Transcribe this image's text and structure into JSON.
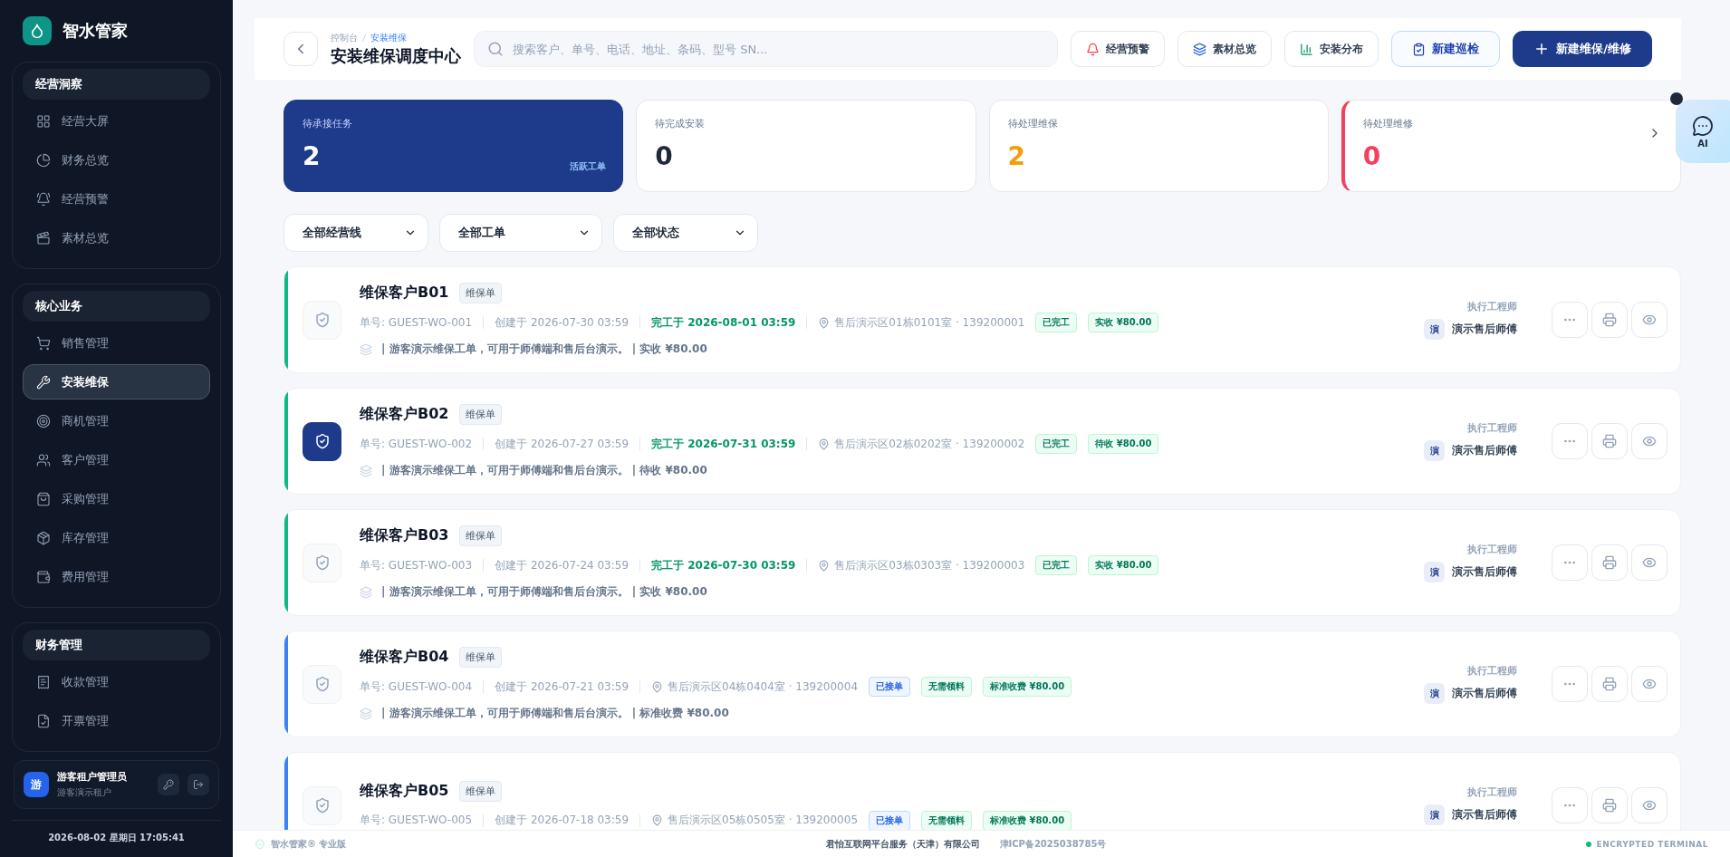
{
  "brand": {
    "name": "智水管家"
  },
  "sidebar": {
    "groups": [
      {
        "title": "经营洞察",
        "items": [
          {
            "label": "经营大屏",
            "selected": false
          },
          {
            "label": "财务总览",
            "selected": false
          },
          {
            "label": "经营预警",
            "selected": false
          },
          {
            "label": "素材总览",
            "selected": false
          }
        ]
      },
      {
        "title": "核心业务",
        "items": [
          {
            "label": "销售管理",
            "selected": false
          },
          {
            "label": "安装维保",
            "selected": true
          },
          {
            "label": "商机管理",
            "selected": false
          },
          {
            "label": "客户管理",
            "selected": false
          },
          {
            "label": "采购管理",
            "selected": false
          },
          {
            "label": "库存管理",
            "selected": false
          },
          {
            "label": "费用管理",
            "selected": false
          }
        ]
      },
      {
        "title": "财务管理",
        "items": [
          {
            "label": "收款管理",
            "selected": false
          },
          {
            "label": "开票管理",
            "selected": false
          }
        ]
      }
    ],
    "user": {
      "avatar": "游",
      "name": "游客租户管理员",
      "tenant": "游客演示租户"
    },
    "datetime": "2026-08-02 星期日 17:05:41"
  },
  "header": {
    "breadcrumb": [
      "控制台",
      "安装维保"
    ],
    "title": "安装维保调度中心",
    "search": {
      "placeholder": "搜索客户、单号、电话、地址、条码、型号 SN..."
    },
    "buttons": [
      {
        "label": "经营预警",
        "kind": "alert"
      },
      {
        "label": "素材总览",
        "kind": "materials"
      },
      {
        "label": "安装分布",
        "kind": "chart"
      },
      {
        "label": "新建巡检",
        "kind": "outline"
      },
      {
        "label": "新建维保/维修",
        "kind": "primary"
      }
    ]
  },
  "stats": [
    {
      "label": "待承接任务",
      "value": "2",
      "selected": true,
      "note": "活跃工单",
      "color": "#ffffff",
      "flagged": false
    },
    {
      "label": "待完成安装",
      "value": "0",
      "selected": false,
      "color": "#1e293b",
      "flagged": false
    },
    {
      "label": "待处理维保",
      "value": "2",
      "selected": false,
      "color": "#f59e0b",
      "flagged": false
    },
    {
      "label": "待处理维修",
      "value": "0",
      "selected": false,
      "color": "#f43f5e",
      "flagged": true
    }
  ],
  "filters": [
    "全部经营线",
    "全部工单",
    "全部状态"
  ],
  "ai_button": {
    "label": "AI"
  },
  "orders": [
    {
      "title": "维保客户B01",
      "tag": "维保单",
      "number": "单号: GUEST-WO-001",
      "created": "创建于 2026-07-30 03:59",
      "completed": "完工于 2026-08-01 03:59",
      "address": "售后演示区01栋0101室 · 139200001",
      "badges": [
        {
          "label": "已完工",
          "kind": "success"
        },
        {
          "label": "实收 ¥80.00",
          "kind": "success"
        }
      ],
      "description": "| 游客演示维保工单，可用于师傅端和售后台演示。 | 实收 ¥80.00",
      "engineer_label": "执行工程师",
      "engineer_avatar": "演",
      "engineer": "演示售后师傅",
      "color": "#10b981",
      "selected": false
    },
    {
      "title": "维保客户B02",
      "tag": "维保单",
      "number": "单号: GUEST-WO-002",
      "created": "创建于 2026-07-27 03:59",
      "completed": "完工于 2026-07-31 03:59",
      "address": "售后演示区02栋0202室 · 139200002",
      "badges": [
        {
          "label": "已完工",
          "kind": "success"
        },
        {
          "label": "待收 ¥80.00",
          "kind": "success"
        }
      ],
      "description": "| 游客演示维保工单，可用于师傅端和售后台演示。 | 待收 ¥80.00",
      "engineer_label": "执行工程师",
      "engineer_avatar": "演",
      "engineer": "演示售后师傅",
      "color": "#10b981",
      "selected": true
    },
    {
      "title": "维保客户B03",
      "tag": "维保单",
      "number": "单号: GUEST-WO-003",
      "created": "创建于 2026-07-24 03:59",
      "completed": "完工于 2026-07-30 03:59",
      "address": "售后演示区03栋0303室 · 139200003",
      "badges": [
        {
          "label": "已完工",
          "kind": "success"
        },
        {
          "label": "实收 ¥80.00",
          "kind": "success"
        }
      ],
      "description": "| 游客演示维保工单，可用于师傅端和售后台演示。 | 实收 ¥80.00",
      "engineer_label": "执行工程师",
      "engineer_avatar": "演",
      "engineer": "演示售后师傅",
      "color": "#10b981",
      "selected": false
    },
    {
      "title": "维保客户B04",
      "tag": "维保单",
      "number": "单号: GUEST-WO-004",
      "created": "创建于 2026-07-21 03:59",
      "address": "售后演示区04栋0404室 · 139200004",
      "badges": [
        {
          "label": "已接单",
          "kind": "info"
        },
        {
          "label": "无需领料",
          "kind": "success"
        },
        {
          "label": "标准收费 ¥80.00",
          "kind": "success"
        }
      ],
      "description": "| 游客演示维保工单，可用于师傅端和售后台演示。 | 标准收费 ¥80.00",
      "engineer_label": "执行工程师",
      "engineer_avatar": "演",
      "engineer": "演示售后师傅",
      "color": "#3b82f6",
      "selected": false
    },
    {
      "title": "维保客户B05",
      "tag": "维保单",
      "number": "单号: GUEST-WO-005",
      "created": "创建于 2026-07-18 03:59",
      "address": "售后演示区05栋0505室 · 139200005",
      "badges": [
        {
          "label": "已接单",
          "kind": "info"
        },
        {
          "label": "无需领料",
          "kind": "success"
        },
        {
          "label": "标准收费 ¥80.00",
          "kind": "success"
        }
      ],
      "engineer_label": "执行工程师",
      "engineer_avatar": "演",
      "engineer": "演示售后师傅",
      "color": "#3b82f6",
      "selected": false
    }
  ],
  "footer": {
    "edition": "智水管家® 专业版",
    "company": "君怡互联网平台服务（天津）有限公司",
    "icp": "津ICP备2025038785号",
    "status": "ENCRYPTED TERMINAL"
  }
}
